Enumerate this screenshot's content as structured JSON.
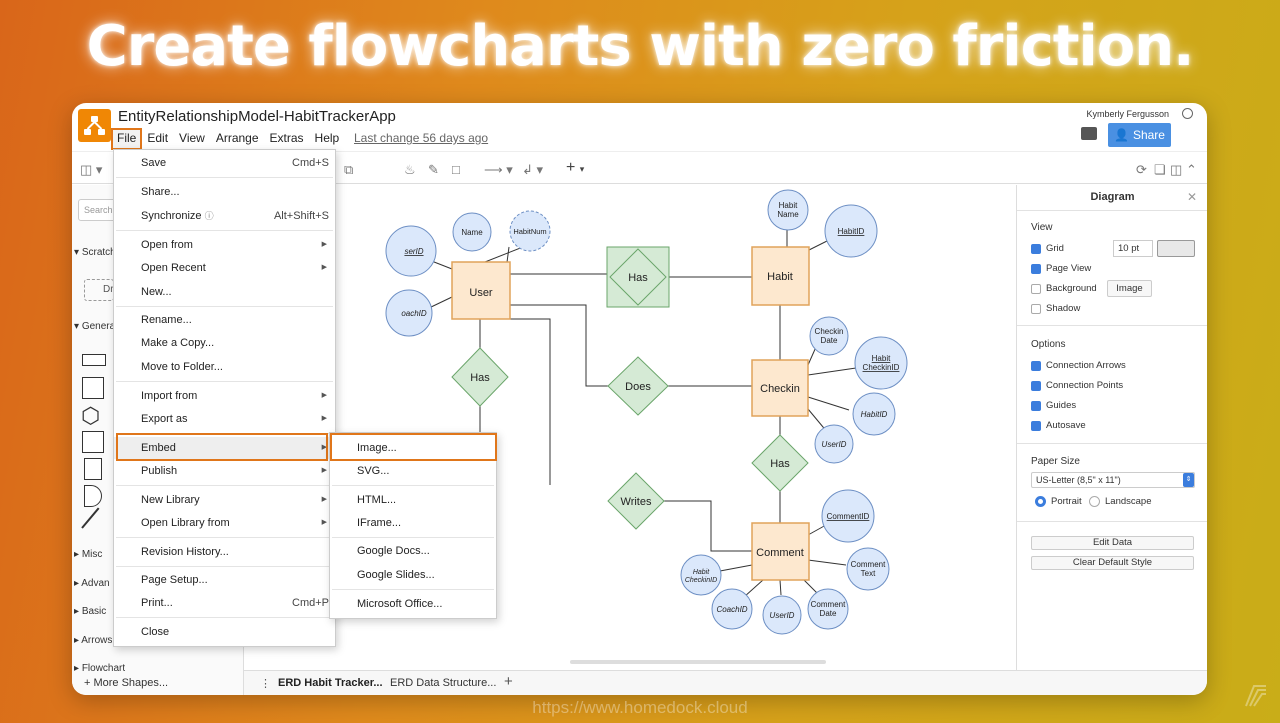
{
  "headline": "Create flowcharts with zero friction.",
  "watermark": "https://www.homedock.cloud",
  "app": {
    "doc_title": "EntityRelationshipModel-HabitTrackerApp",
    "menu": [
      "File",
      "Edit",
      "View",
      "Arrange",
      "Extras",
      "Help"
    ],
    "last_change": "Last change 56 days ago",
    "user_name": "Kymberly Fergusson",
    "share_label": "Share"
  },
  "sidebar": {
    "search_placeholder": "Search",
    "scratchpad": "Scratch",
    "scratch_btn": "Dr",
    "general": "Genera",
    "misc": "Misc",
    "advanced": "Advan",
    "basic": "Basic",
    "arrows": "Arrows",
    "flowchart": "Flowchart",
    "more_shapes": "+ More Shapes..."
  },
  "file_menu": {
    "save": "Save",
    "save_sc": "Cmd+S",
    "share": "Share...",
    "sync": "Synchronize",
    "sync_sc": "Alt+Shift+S",
    "open_from": "Open from",
    "open_recent": "Open Recent",
    "new": "New...",
    "rename": "Rename...",
    "make_copy": "Make a Copy...",
    "move_folder": "Move to Folder...",
    "import_from": "Import from",
    "export_as": "Export as",
    "embed": "Embed",
    "publish": "Publish",
    "new_library": "New Library",
    "open_library": "Open Library from",
    "revision": "Revision History...",
    "page_setup": "Page Setup...",
    "print": "Print...",
    "print_sc": "Cmd+P",
    "close": "Close"
  },
  "embed_menu": {
    "image": "Image...",
    "svg": "SVG...",
    "html": "HTML...",
    "iframe": "IFrame...",
    "gdocs": "Google Docs...",
    "gslides": "Google Slides...",
    "office": "Microsoft Office..."
  },
  "diagram": {
    "entities": {
      "user": "User",
      "habit": "Habit",
      "checkin": "Checkin",
      "comment": "Comment"
    },
    "relations": {
      "has1": "Has",
      "has2": "Has",
      "does": "Does",
      "has3": "Has",
      "writes": "Writes"
    },
    "attrs": {
      "name": "Name",
      "habitnum": "HabitNum",
      "userid_cut": "serID",
      "coachid_cut": "oachID",
      "habit_name_1": "Habit",
      "habit_name_2": "Name",
      "habitid": "HabitID",
      "checkin_date_1": "Checkin",
      "checkin_date_2": "Date",
      "habit_checkinid_1": "Habit",
      "habit_checkinid_2": "CheckinID",
      "habitid2": "HabitID",
      "userid2": "UserID",
      "commentid": "CommentID",
      "comment_text_1": "Comment",
      "comment_text_2": "Text",
      "comment_date_1": "Comment",
      "comment_date_2": "Date",
      "c_habit_1": "Habit",
      "c_habit_2": "CheckinID",
      "c_coachid": "CoachID",
      "c_userid": "UserID"
    }
  },
  "panel": {
    "title": "Diagram",
    "view": "View",
    "grid": "Grid",
    "grid_size": "10 pt",
    "page_view": "Page View",
    "background": "Background",
    "image_btn": "Image",
    "shadow": "Shadow",
    "options": "Options",
    "conn_arrows": "Connection Arrows",
    "conn_points": "Connection Points",
    "guides": "Guides",
    "autosave": "Autosave",
    "paper_size": "Paper Size",
    "paper_value": "US-Letter (8,5\" x 11\")",
    "portrait": "Portrait",
    "landscape": "Landscape",
    "edit_data": "Edit Data",
    "clear_style": "Clear Default Style"
  },
  "pages": {
    "tab1": "ERD Habit Tracker...",
    "tab2": "ERD Data Structure..."
  },
  "colors": {
    "accent": "#e0761a",
    "share": "#4a90e2",
    "entity_fill": "#fde8cf",
    "entity_stroke": "#e0a35a",
    "rel_fill": "#d5ead5",
    "rel_stroke": "#6aa56a",
    "attr_fill": "#dbe8fb",
    "attr_stroke": "#6d8fc4"
  }
}
